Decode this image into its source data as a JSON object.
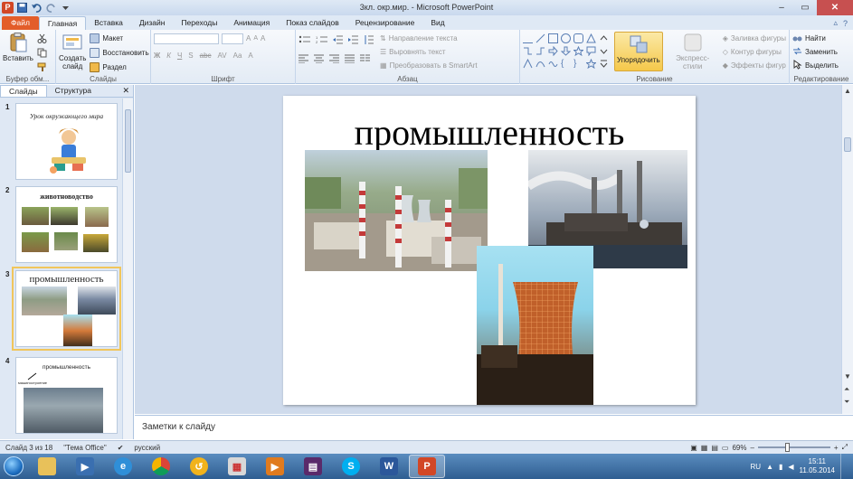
{
  "window": {
    "title": "3кл. окр.мир. - Microsoft PowerPoint",
    "controls": {
      "minimize": "–",
      "maximize": "▭",
      "close": "✕"
    }
  },
  "ribbon_tabs": [
    {
      "label": "Файл"
    },
    {
      "label": "Главная"
    },
    {
      "label": "Вставка"
    },
    {
      "label": "Дизайн"
    },
    {
      "label": "Переходы"
    },
    {
      "label": "Анимация"
    },
    {
      "label": "Показ слайдов"
    },
    {
      "label": "Рецензирование"
    },
    {
      "label": "Вид"
    }
  ],
  "ribbon": {
    "clipboard": {
      "paste": "Вставить",
      "label": "Буфер обм..."
    },
    "slides": {
      "create": "Создать",
      "create2": "слайд",
      "layout": "Макет",
      "reset": "Восстановить",
      "section": "Раздел",
      "label": "Слайды"
    },
    "font": {
      "label": "Шрифт",
      "bold": "Ж",
      "italic": "К",
      "underline": "Ч",
      "strike": "S",
      "abc": "abc",
      "spacing": "AV",
      "case": "Aa",
      "grow": "A",
      "shrink": "A",
      "clear": "A"
    },
    "paragraph": {
      "direction": "Направление текста",
      "align": "Выровнять текст",
      "smartart": "Преобразовать в SmartArt",
      "label": "Абзац"
    },
    "drawing": {
      "arrange": "Упорядочить",
      "quickstyles": "Экспресс-стили",
      "fill": "Заливка фигуры",
      "outline": "Контур фигуры",
      "effects": "Эффекты фигур",
      "label": "Рисование"
    },
    "editing": {
      "find": "Найти",
      "replace": "Заменить",
      "select": "Выделить",
      "label": "Редактирование"
    }
  },
  "panel": {
    "tabs": [
      "Слайды",
      "Структура"
    ],
    "close": "✕",
    "thumbs": [
      {
        "num": "1",
        "title": "Урок окружающего мира"
      },
      {
        "num": "2",
        "title": "животноводство"
      },
      {
        "num": "3",
        "title": "промышленность"
      },
      {
        "num": "4",
        "title": "промышленность",
        "sub": "машиностроение"
      }
    ]
  },
  "slide": {
    "title": "промышленность"
  },
  "notes": {
    "placeholder": "Заметки к слайду"
  },
  "status": {
    "slide": "Слайд 3 из 18",
    "theme": "\"Тема Office\"",
    "lang": "русский",
    "zoom": "69%",
    "zoom_minus": "–",
    "zoom_plus": "+"
  },
  "tray": {
    "lang": "RU",
    "time": "15:11",
    "date": "11.05.2014"
  },
  "colors": {
    "file_tab": "#e35d2a",
    "accent": "#2b579a",
    "slide_bg": "#ffffff",
    "selection": "#f1c65c"
  }
}
